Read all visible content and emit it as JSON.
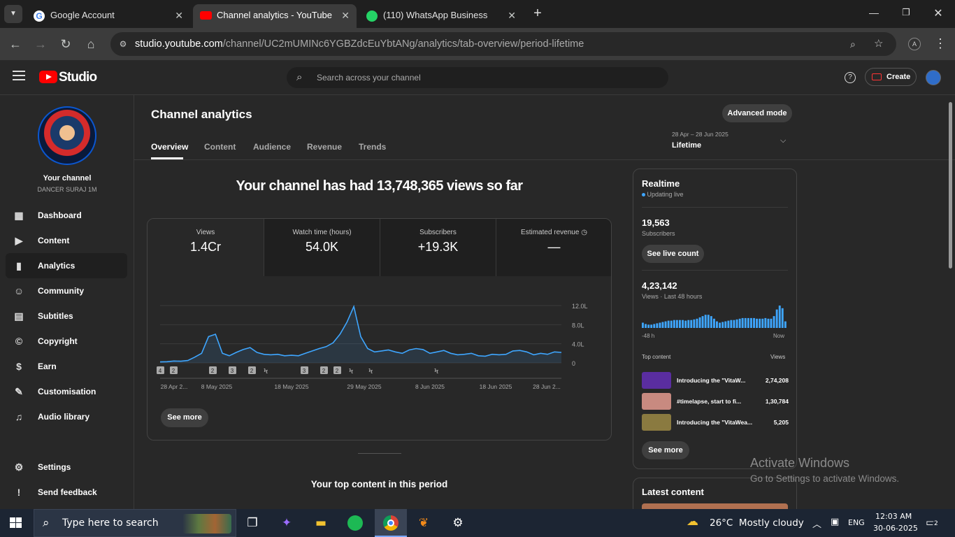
{
  "browser": {
    "tabs": [
      {
        "title": "Google Account",
        "icon": "google-icon"
      },
      {
        "title": "Channel analytics - YouTube Studio",
        "icon": "youtube-icon"
      },
      {
        "title": "(110) WhatsApp Business",
        "icon": "whatsapp-icon"
      }
    ],
    "url_domain": "studio.youtube.com",
    "url_path": "/channel/UC2mUMINc6YGBZdcEuYbtANg/analytics/tab-overview/period-lifetime",
    "profile_initial": "A"
  },
  "studio": {
    "logo_text": "Studio",
    "search_placeholder": "Search across your channel",
    "create_label": "Create"
  },
  "sidebar": {
    "channel_title": "Your channel",
    "channel_name": "DANCER SURAJ 1M",
    "items": [
      {
        "label": "Dashboard",
        "icon": "dashboard-icon"
      },
      {
        "label": "Content",
        "icon": "content-icon"
      },
      {
        "label": "Analytics",
        "icon": "analytics-icon"
      },
      {
        "label": "Community",
        "icon": "community-icon"
      },
      {
        "label": "Subtitles",
        "icon": "subtitles-icon"
      },
      {
        "label": "Copyright",
        "icon": "copyright-icon"
      },
      {
        "label": "Earn",
        "icon": "earn-icon"
      },
      {
        "label": "Customisation",
        "icon": "customisation-icon"
      },
      {
        "label": "Audio library",
        "icon": "audio-library-icon"
      }
    ],
    "footer": [
      {
        "label": "Settings",
        "icon": "settings-icon"
      },
      {
        "label": "Send feedback",
        "icon": "feedback-icon"
      }
    ]
  },
  "analytics": {
    "title": "Channel analytics",
    "advanced_mode": "Advanced mode",
    "tabs": [
      "Overview",
      "Content",
      "Audience",
      "Revenue",
      "Trends"
    ],
    "period_range": "28 Apr – 28 Jun 2025",
    "period_label": "Lifetime",
    "headline": "Your channel has had 13,748,365 views so far",
    "metrics": [
      {
        "label": "Views",
        "value": "1.4Cr"
      },
      {
        "label": "Watch time (hours)",
        "value": "54.0K"
      },
      {
        "label": "Subscribers",
        "value": "+19.3K"
      },
      {
        "label": "Estimated revenue",
        "value": "—"
      }
    ],
    "see_more": "See more",
    "top_content_heading": "Your top content in this period",
    "video_markers": [
      "4",
      "2",
      "2",
      "3",
      "2",
      "",
      "3",
      "2",
      "2",
      "",
      "",
      ""
    ]
  },
  "chart_data": {
    "type": "area",
    "x_ticks": [
      "28 Apr 2...",
      "8 May 2025",
      "18 May 2025",
      "29 May 2025",
      "8 Jun 2025",
      "18 Jun 2025",
      "28 Jun 2..."
    ],
    "y_ticks": [
      "12.0L",
      "8.0L",
      "4.0L",
      "0"
    ],
    "ylim": [
      0,
      1200000
    ],
    "series": [
      {
        "values": [
          20000,
          25000,
          40000,
          35000,
          50000,
          120000,
          200000,
          550000,
          600000,
          200000,
          150000,
          220000,
          280000,
          320000,
          220000,
          180000,
          170000,
          180000,
          150000,
          160000,
          150000,
          200000,
          250000,
          300000,
          340000,
          420000,
          600000,
          850000,
          1180000,
          550000,
          300000,
          230000,
          250000,
          270000,
          230000,
          200000,
          270000,
          300000,
          280000,
          200000,
          230000,
          260000,
          200000,
          170000,
          180000,
          200000,
          150000,
          140000,
          180000,
          170000,
          180000,
          250000,
          260000,
          230000,
          170000,
          200000,
          180000,
          230000,
          220000
        ]
      }
    ],
    "grid": true
  },
  "realtime": {
    "title": "Realtime",
    "status": "Updating live",
    "subscribers_value": "19,563",
    "subscribers_label": "Subscribers",
    "see_live_count": "See live count",
    "views_value": "4,23,142",
    "views_label": "Views · Last 48 hours",
    "axis_start": "-48 h",
    "axis_end": "Now",
    "top_content_label": "Top content",
    "views_col_label": "Views",
    "hourly_views": [
      8,
      6,
      5,
      5,
      6,
      7,
      8,
      9,
      10,
      11,
      11,
      12,
      12,
      12,
      12,
      11,
      12,
      12,
      13,
      14,
      16,
      18,
      20,
      20,
      18,
      14,
      10,
      8,
      9,
      10,
      11,
      12,
      12,
      13,
      14,
      15,
      15,
      15,
      15,
      15,
      14,
      14,
      14,
      15,
      14,
      14,
      18,
      28,
      34,
      30,
      10
    ],
    "top_items": [
      {
        "title": "Introducing the \"VitaW...",
        "views": "2,74,208",
        "thumb": "#5a2da0"
      },
      {
        "title": "#timelapse, start to fi...",
        "views": "1,30,784",
        "thumb": "#c88a80"
      },
      {
        "title": "Introducing the \"VitaWea...",
        "views": "5,205",
        "thumb": "#8a7a40"
      }
    ],
    "see_more": "See more",
    "latest_content": "Latest content"
  },
  "windows": {
    "watermark_title": "Activate Windows",
    "watermark_sub": "Go to Settings to activate Windows.",
    "search_text": "Type here to search",
    "weather": "26°C  Mostly cloudy",
    "lang": "ENG",
    "time": "12:03 AM",
    "date": "30-06-2025",
    "notif_count": "2"
  }
}
